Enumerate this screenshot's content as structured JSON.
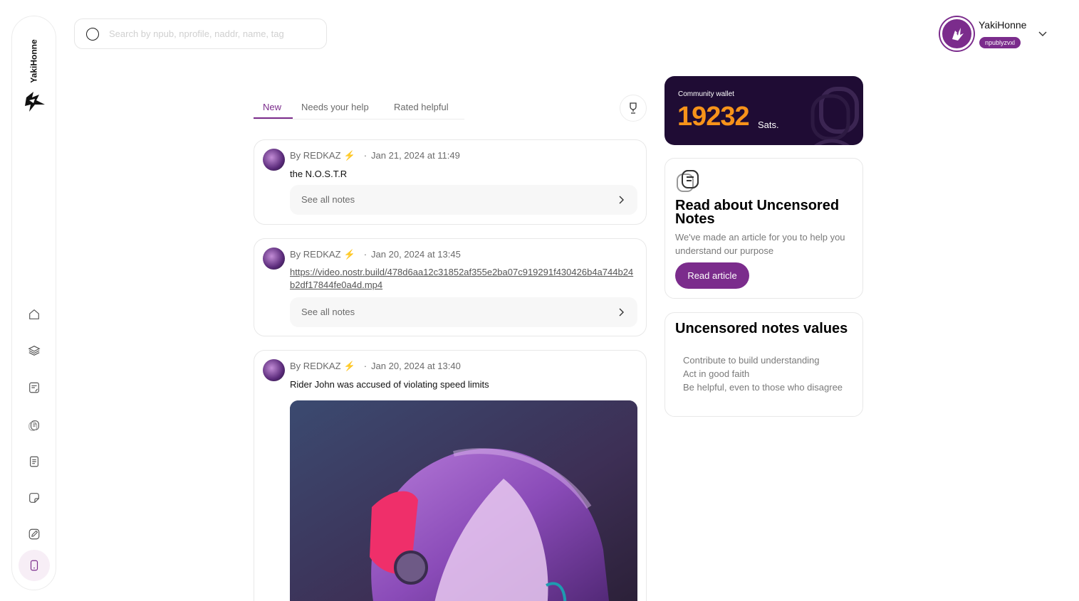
{
  "app": {
    "brand": "YakiHonne"
  },
  "search": {
    "placeholder": "Search by npub, nprofile, naddr, name, tag"
  },
  "user": {
    "name": "YakiHonne",
    "npub": "npublyzvxl"
  },
  "tabs": [
    {
      "label": "New",
      "active": true
    },
    {
      "label": "Needs your help",
      "active": false
    },
    {
      "label": "Rated helpful",
      "active": false
    }
  ],
  "notes": [
    {
      "author": "By REDKAZ",
      "date": "Jan 21, 2024 at 11:49",
      "content": "the N.O.S.T.R",
      "see_all": "See all notes"
    },
    {
      "author": "By REDKAZ",
      "date": "Jan 20, 2024 at 13:45",
      "link": "https://video.nostr.build/478d6aa12c31852af355e2ba07c919291f430426b4a744b24b2df17844fe0a4d.mp4",
      "see_all": "See all notes"
    },
    {
      "author": "By REDKAZ",
      "date": "Jan 20, 2024 at 13:40",
      "content": "Rider John was accused of violating speed limits"
    }
  ],
  "wallet": {
    "label": "Community wallet",
    "amount": "19232",
    "unit": "Sats."
  },
  "read_about": {
    "title": "Read about Uncensored Notes",
    "description": "We've made an article for you to help you understand our purpose",
    "button": "Read article"
  },
  "values": {
    "title": "Uncensored notes values",
    "items": [
      "Contribute to build understanding",
      "Act in good faith",
      "Be helpful, even to those who disagree"
    ]
  },
  "colors": {
    "accent": "#7b2c8c",
    "wallet_bg": "#1f0c34",
    "wallet_amount": "#f7931a",
    "bolt": "#f5b823"
  }
}
